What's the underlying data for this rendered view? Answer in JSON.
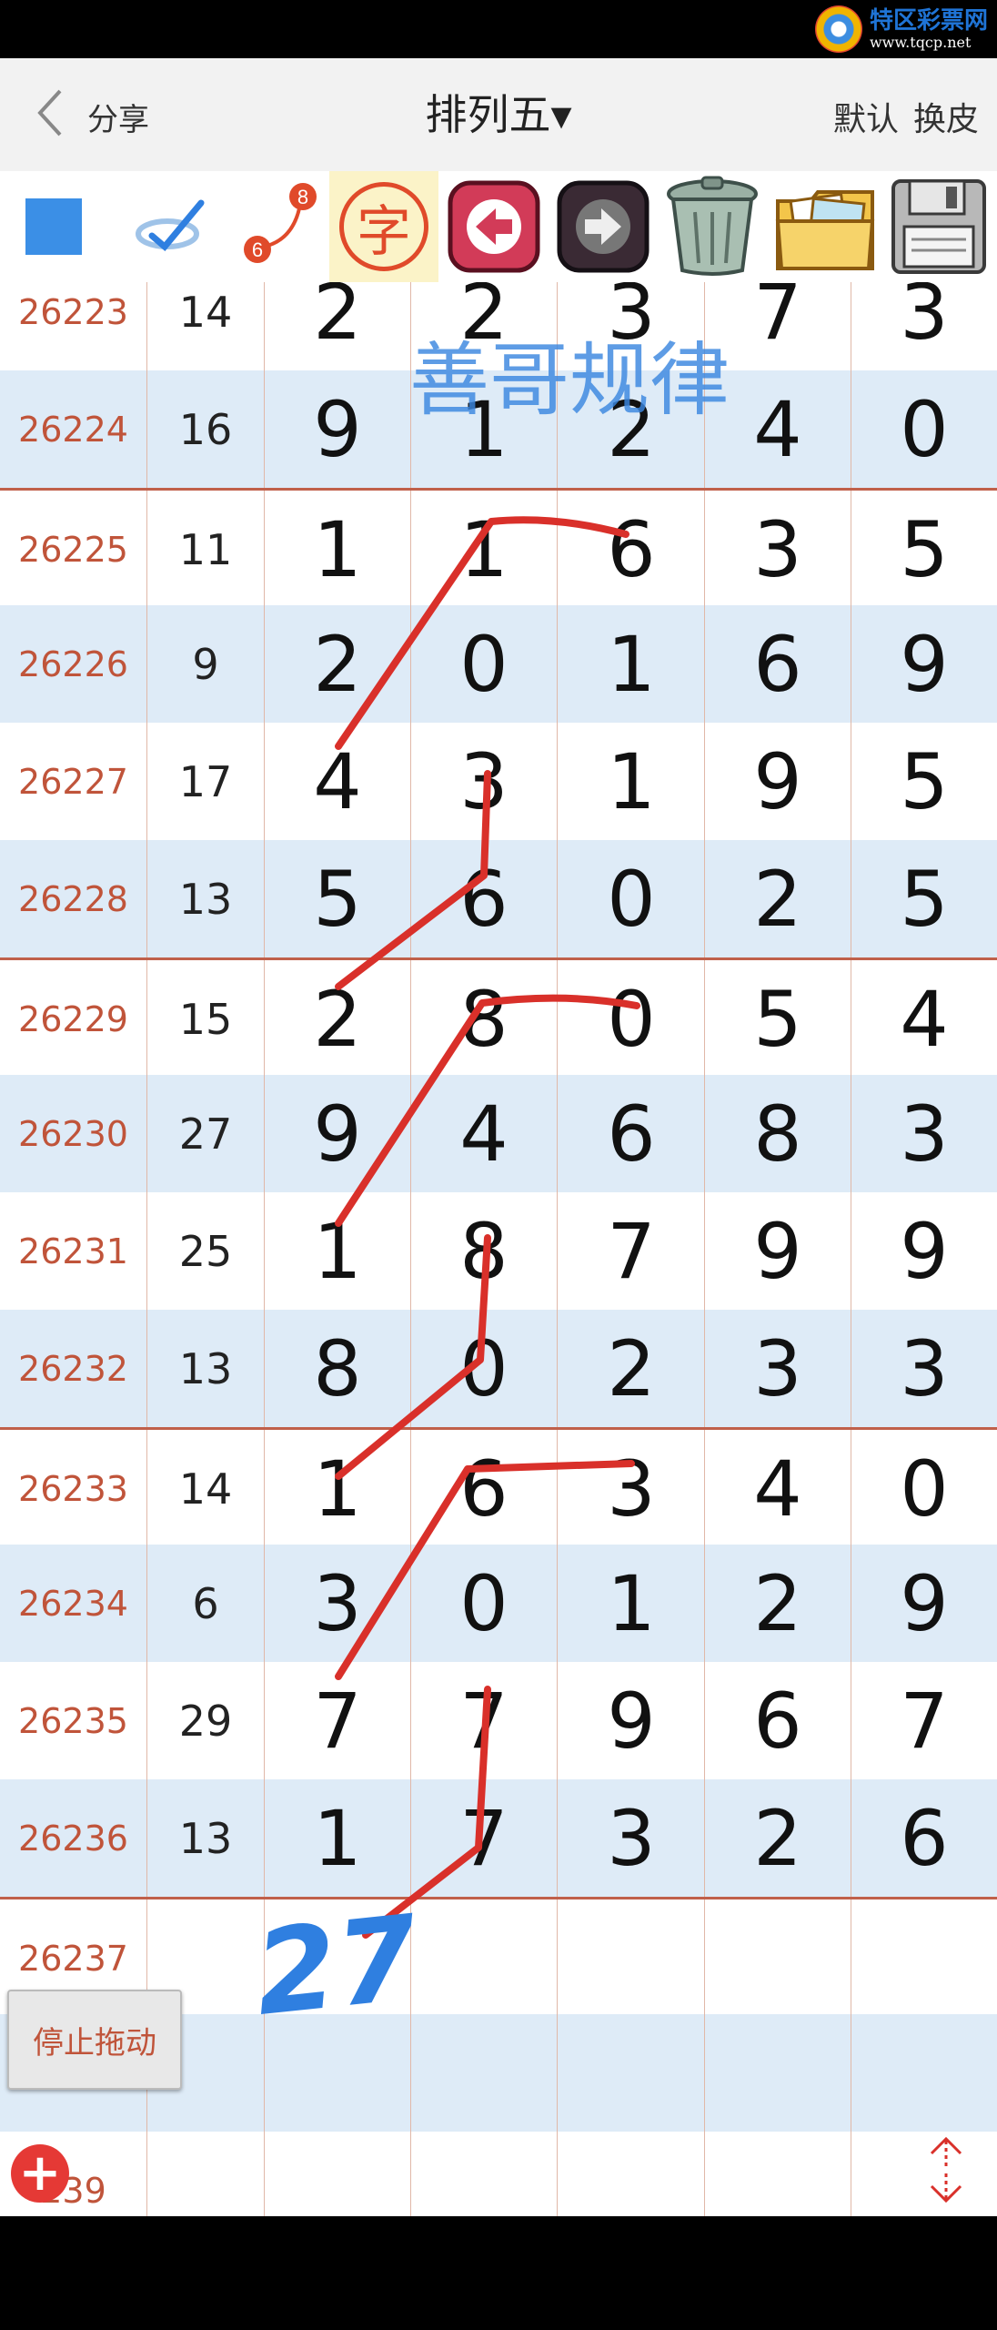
{
  "watermark": {
    "name": "特区彩票网",
    "url": "www.tqcp.net"
  },
  "header": {
    "back_label": "分享",
    "title": "排列五",
    "title_caret": "▾",
    "skin_default": "默认",
    "skin_change": "换皮"
  },
  "toolbar": {
    "badge_top": "8",
    "badge_bottom": "6",
    "char_tool": "字"
  },
  "annotation_text": "善哥规律",
  "handwritten_note": "27",
  "rows": [
    {
      "issue": "26223",
      "sum": "14",
      "digits": [
        "2",
        "2",
        "3",
        "7",
        "3"
      ]
    },
    {
      "issue": "26224",
      "sum": "16",
      "digits": [
        "9",
        "1",
        "2",
        "4",
        "0"
      ]
    },
    {
      "issue": "26225",
      "sum": "11",
      "digits": [
        "1",
        "1",
        "6",
        "3",
        "5"
      ]
    },
    {
      "issue": "26226",
      "sum": "9",
      "digits": [
        "2",
        "0",
        "1",
        "6",
        "9"
      ]
    },
    {
      "issue": "26227",
      "sum": "17",
      "digits": [
        "4",
        "3",
        "1",
        "9",
        "5"
      ]
    },
    {
      "issue": "26228",
      "sum": "13",
      "digits": [
        "5",
        "6",
        "0",
        "2",
        "5"
      ]
    },
    {
      "issue": "26229",
      "sum": "15",
      "digits": [
        "2",
        "8",
        "0",
        "5",
        "4"
      ]
    },
    {
      "issue": "26230",
      "sum": "27",
      "digits": [
        "9",
        "4",
        "6",
        "8",
        "3"
      ]
    },
    {
      "issue": "26231",
      "sum": "25",
      "digits": [
        "1",
        "8",
        "7",
        "9",
        "9"
      ]
    },
    {
      "issue": "26232",
      "sum": "13",
      "digits": [
        "8",
        "0",
        "2",
        "3",
        "3"
      ]
    },
    {
      "issue": "26233",
      "sum": "14",
      "digits": [
        "1",
        "6",
        "3",
        "4",
        "0"
      ]
    },
    {
      "issue": "26234",
      "sum": "6",
      "digits": [
        "3",
        "0",
        "1",
        "2",
        "9"
      ]
    },
    {
      "issue": "26235",
      "sum": "29",
      "digits": [
        "7",
        "7",
        "9",
        "6",
        "7"
      ]
    },
    {
      "issue": "26236",
      "sum": "13",
      "digits": [
        "1",
        "7",
        "3",
        "2",
        "6"
      ]
    },
    {
      "issue": "26237",
      "sum": "",
      "digits": [
        "",
        "",
        "",
        "",
        ""
      ]
    },
    {
      "issue": "",
      "sum": "",
      "digits": [
        "",
        "",
        "",
        "",
        ""
      ]
    },
    {
      "issue": "239",
      "sum": "",
      "digits": [
        "",
        "",
        "",
        "",
        ""
      ]
    }
  ],
  "stop_drag_label": "停止拖动",
  "add_icon_glyph": "+",
  "colors": {
    "issue_text": "#c0543a",
    "alt_row": "#deebf7",
    "annotation_line": "#d9302a",
    "annotation_blue": "#2f7fe0"
  }
}
